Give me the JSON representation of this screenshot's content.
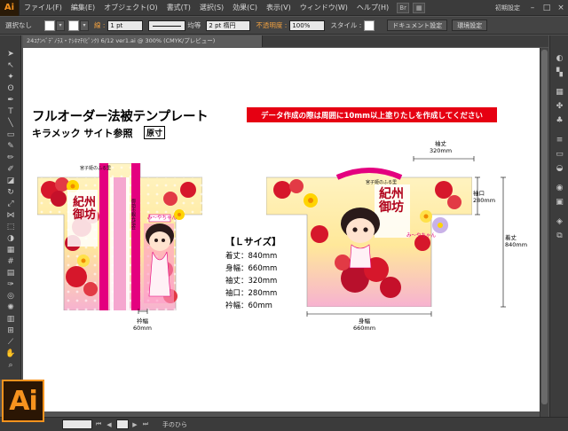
{
  "app": {
    "logo": "Ai",
    "badge": "Ai",
    "workspace": "初期設定"
  },
  "menu": [
    "ファイル(F)",
    "編集(E)",
    "オブジェクト(O)",
    "書式(T)",
    "選択(S)",
    "効果(C)",
    "表示(V)",
    "ウィンドウ(W)",
    "ヘルプ(H)"
  ],
  "control": {
    "selection": "選択なし",
    "stroke_label": "線 :",
    "stroke_weight": "1 pt",
    "brush_label": "均等",
    "brush_value": "2 pt 楕円",
    "opacity_label": "不透明度 :",
    "opacity_value": "100%",
    "style_label": "スタイル :",
    "doc_setup": "ドキュメント設定",
    "prefs": "環境設定"
  },
  "document": {
    "tab_label": "24ﾕﾅﾝﾍﾞﾃﾞﾉﾗｽ・ﾅｼﾈﾏﾁ(ﾋﾟﾝｸ) 6/12 ver1.ai @ 300% (CMYK/プレビュー)"
  },
  "status": {
    "tool": "手のひら"
  },
  "artboard": {
    "title": "フルオーダー法被テンプレート",
    "banner": "データ作成の際は周囲に10mm以上塗りたしを作成してください",
    "subtitle": "キラメック サイト参照",
    "actual_size": "原寸",
    "spec_title": "【Ｌサイズ】",
    "specs": [
      "着丈：840mm",
      "身幅：660mm",
      "袖丈：320mm",
      "袖口：280mm",
      "衿幅：60mm"
    ],
    "dims": {
      "collar": [
        "衿幅",
        "60mm"
      ],
      "sleeve": [
        "袖丈",
        "320mm"
      ],
      "cuff": [
        "袖口",
        "280mm"
      ],
      "length": [
        "着丈",
        "840mm"
      ],
      "body": [
        "身幅",
        "660mm"
      ]
    },
    "front": {
      "title": "紀州御坊",
      "left_band": "宮子姫のふる里",
      "right_band": "御坊市観光協会",
      "nameplate": "み〜やちゃん"
    },
    "back": {
      "title": "紀州御坊",
      "left_band": "宮子姫のふる里",
      "nameplate": "み〜やちゃん"
    }
  },
  "colors": {
    "accent": "#f7931e",
    "banner": "#e60012",
    "band_pink": "#e4007f"
  }
}
